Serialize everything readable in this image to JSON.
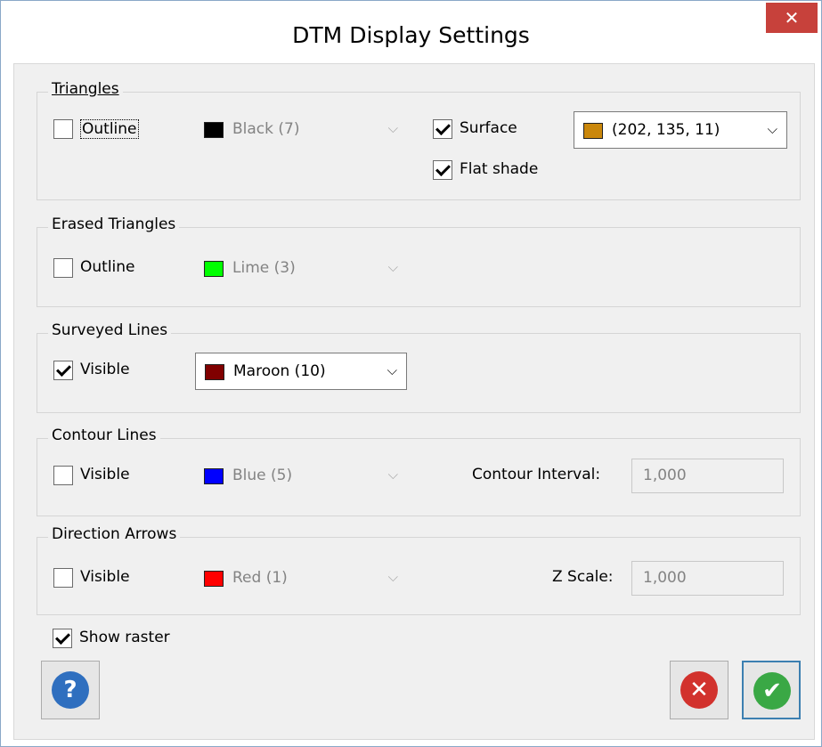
{
  "window": {
    "title": "DTM Display Settings",
    "close_glyph": "✕"
  },
  "triangles": {
    "legend": "Triangles",
    "outline_label": "Outline",
    "outline_checked": false,
    "outline_color": {
      "label": "Black (7)",
      "swatch": "#000000",
      "enabled": false
    },
    "surface_label": "Surface",
    "surface_checked": true,
    "surface_color": {
      "label": "(202, 135, 11)",
      "swatch": "#ca870b",
      "enabled": true
    },
    "flat_shade_label": "Flat shade",
    "flat_shade_checked": true
  },
  "erased_triangles": {
    "legend": "Erased Triangles",
    "outline_label": "Outline",
    "outline_checked": false,
    "outline_color": {
      "label": "Lime (3)",
      "swatch": "#00ff00",
      "enabled": false
    }
  },
  "surveyed_lines": {
    "legend": "Surveyed Lines",
    "visible_label": "Visible",
    "visible_checked": true,
    "color": {
      "label": "Maroon (10)",
      "swatch": "#800000",
      "enabled": true
    }
  },
  "contour_lines": {
    "legend": "Contour Lines",
    "visible_label": "Visible",
    "visible_checked": false,
    "color": {
      "label": "Blue (5)",
      "swatch": "#0000ff",
      "enabled": false
    },
    "interval_label": "Contour Interval:",
    "interval_value": "1,000"
  },
  "direction_arrows": {
    "legend": "Direction Arrows",
    "visible_label": "Visible",
    "visible_checked": false,
    "color": {
      "label": "Red (1)",
      "swatch": "#ff0000",
      "enabled": false
    },
    "z_scale_label": "Z Scale:",
    "z_scale_value": "1,000"
  },
  "show_raster": {
    "label": "Show raster",
    "checked": true
  },
  "buttons": {
    "help_glyph": "?",
    "cancel_glyph": "✕",
    "ok_glyph": "✔"
  },
  "colors": {
    "help": "#2f6fbf",
    "cancel": "#d2322d",
    "ok": "#3aa845",
    "close": "#c7413b"
  }
}
